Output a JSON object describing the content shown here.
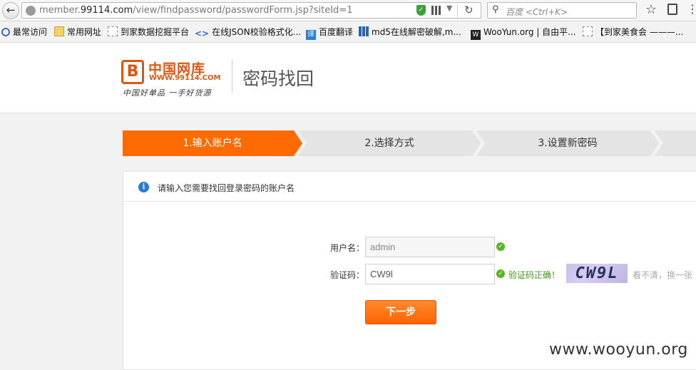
{
  "browser": {
    "url_prefix": "member.",
    "url_domain": "99114.com",
    "url_path": "/view/findpassword/passwordForm.jsp?siteId=1",
    "search_placeholder": "百度 <Ctrl+K>"
  },
  "bookmarks": [
    {
      "label": "最常访问"
    },
    {
      "label": "常用网址"
    },
    {
      "label": "到家数据挖掘平台"
    },
    {
      "label": "在线JSON校验格式化..."
    },
    {
      "label": "百度翻译"
    },
    {
      "label": "md5在线解密破解,m..."
    },
    {
      "label": "WooYun.org | 自由平..."
    },
    {
      "label": "【到家美食会 ———..."
    }
  ],
  "site": {
    "logo_cn": "中国网库",
    "logo_url": "WWW.99114.COM",
    "slogan": "中国好单品 一手好货源",
    "page_title": "密码找回"
  },
  "steps": [
    {
      "label": "1.输入账户名",
      "active": true
    },
    {
      "label": "2.选择方式",
      "active": false
    },
    {
      "label": "3.设置新密码",
      "active": false
    },
    {
      "label": "",
      "active": false
    }
  ],
  "form": {
    "notice": "请输入您需要找回登录密码的账户名",
    "username_label": "用户名：",
    "username_value": "admin",
    "captcha_label": "验证码：",
    "captcha_value": "CW9l",
    "captcha_ok_text": "验证码正确！",
    "captcha_image_text": "CW9L",
    "refresh_text": "看不清，换一张",
    "next_label": "下一步"
  },
  "watermark": "www.wooyun.org",
  "colors": {
    "accent": "#ff6b00",
    "success": "#5bb51f",
    "info": "#2b79d9"
  }
}
